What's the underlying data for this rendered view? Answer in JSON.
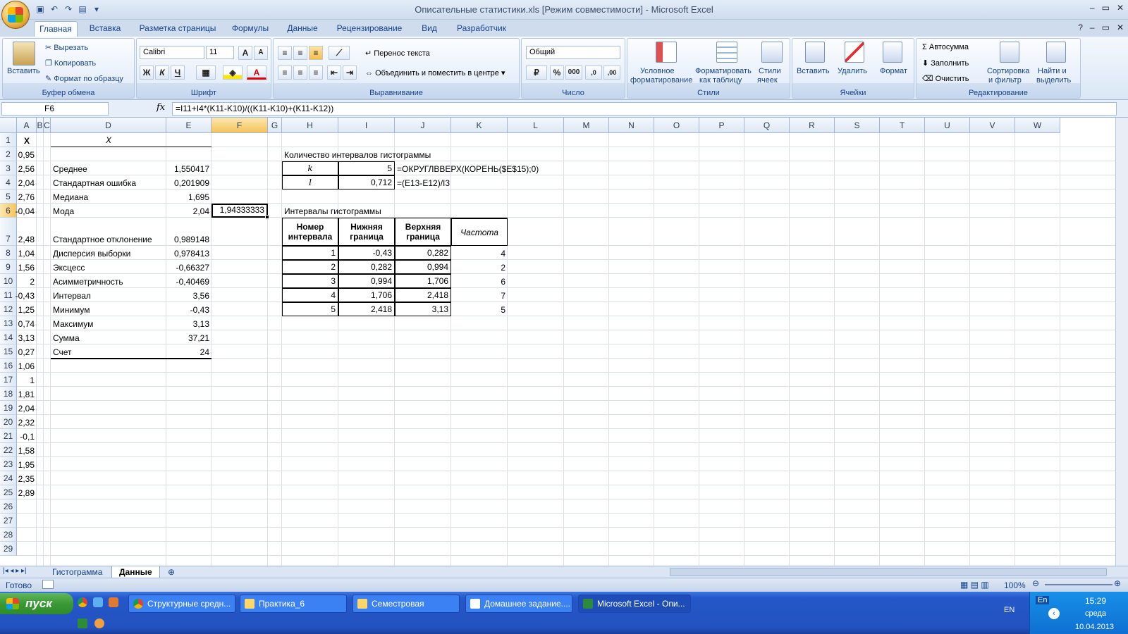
{
  "window": {
    "title": "Описательные статистики.xls  [Режим совместимости] - Microsoft Excel",
    "controls": [
      "–",
      "▭",
      "✕"
    ]
  },
  "ribbon_tabs": [
    "Главная",
    "Вставка",
    "Разметка страницы",
    "Формулы",
    "Данные",
    "Рецензирование",
    "Вид",
    "Разработчик"
  ],
  "active_tab": "Главная",
  "ribbon": {
    "clipboard": {
      "label": "Буфер обмена",
      "paste": "Вставить",
      "cut": "Вырезать",
      "copy": "Копировать",
      "format_painter": "Формат по образцу"
    },
    "font": {
      "label": "Шрифт",
      "name": "Calibri",
      "size": "11",
      "bold": "Ж",
      "italic": "К",
      "underline": "Ч",
      "grow": "A",
      "shrink": "A",
      "color_letter": "A"
    },
    "alignment": {
      "label": "Выравнивание",
      "wrap": "Перенос текста",
      "merge": "Объединить и поместить в центре"
    },
    "number": {
      "label": "Число",
      "format": "Общий",
      "percent": "%",
      "thousands": "000",
      "inc_dec": ",0",
      "dec_dec": ",00"
    },
    "styles": {
      "label": "Стили",
      "conditional": [
        "Условное",
        "форматирование"
      ],
      "as_table": [
        "Форматировать",
        "как таблицу"
      ],
      "cell_styles": [
        "Стили",
        "ячеек"
      ]
    },
    "cells": {
      "label": "Ячейки",
      "insert": "Вставить",
      "delete": "Удалить",
      "format": "Формат"
    },
    "editing": {
      "label": "Редактирование",
      "autosum": "Автосумма",
      "fill": "Заполнить",
      "clear": "Очистить",
      "sort": [
        "Сортировка",
        "и фильтр"
      ],
      "find": [
        "Найти и",
        "выделить"
      ]
    }
  },
  "formula_bar": {
    "name_box": "F6",
    "fx": "fx",
    "formula": "=I11+I4*(K11-K10)/((K11-K10)+(K11-K12))"
  },
  "columns": [
    "A",
    "B",
    "C",
    "D",
    "E",
    "F",
    "G",
    "H",
    "I",
    "J",
    "K",
    "L",
    "M",
    "N",
    "O",
    "P",
    "Q",
    "R",
    "S",
    "T",
    "U",
    "V",
    "W"
  ],
  "rows": [
    "1",
    "2",
    "3",
    "4",
    "5",
    "6",
    "7",
    "8",
    "9",
    "10",
    "11",
    "12",
    "13",
    "14",
    "15",
    "16",
    "17",
    "18",
    "19",
    "20",
    "21",
    "22",
    "23",
    "24",
    "25",
    "26",
    "27",
    "28",
    "29"
  ],
  "colA": {
    "header": "X",
    "values": [
      "0,95",
      "2,56",
      "2,04",
      "2,76",
      "-0,04",
      "2,48",
      "1,04",
      "1,56",
      "2",
      "-0,43",
      "1,25",
      "0,74",
      "3,13",
      "0,27",
      "1,06",
      "1",
      "1,81",
      "2,04",
      "2,32",
      "-0,1",
      "1,58",
      "1,95",
      "2,35",
      "2,89"
    ]
  },
  "stats": {
    "header": "X",
    "labels": [
      "Среднее",
      "Стандартная ошибка",
      "Медиана",
      "Мода",
      "Стандартное отклонение",
      "Дисперсия выборки",
      "Эксцесс",
      "Асимметричность",
      "Интервал",
      "Минимум",
      "Максимум",
      "Сумма",
      "Счет"
    ],
    "values": [
      "1,550417",
      "0,201909",
      "1,695",
      "2,04",
      "0,989148",
      "0,978413",
      "-0,66327",
      "-0,40469",
      "3,56",
      "-0,43",
      "3,13",
      "37,21",
      "24"
    ]
  },
  "active_cell_value": "1,94333333",
  "intervals": {
    "title": "Количество интервалов гистограммы",
    "k_label": "k",
    "k_value": "5",
    "k_formula": "=ОКРУГЛВВЕРХ(КОРЕНЬ($E$15);0)",
    "l_label": "l",
    "l_value": "0,712",
    "l_formula": "=(E13-E12)/I3"
  },
  "hist_table": {
    "title": "Интервалы гистограммы",
    "headers": [
      [
        "Номер",
        "интервала"
      ],
      [
        "Нижняя",
        "граница"
      ],
      [
        "Верхняя",
        "граница"
      ],
      [
        "Частота"
      ]
    ],
    "rows": [
      [
        "1",
        "-0,43",
        "0,282",
        "4"
      ],
      [
        "2",
        "0,282",
        "0,994",
        "2"
      ],
      [
        "3",
        "0,994",
        "1,706",
        "6"
      ],
      [
        "4",
        "1,706",
        "2,418",
        "7"
      ],
      [
        "5",
        "2,418",
        "3,13",
        "5"
      ]
    ]
  },
  "sheets": [
    "Гистограмма",
    "Данные"
  ],
  "active_sheet": "Данные",
  "status": {
    "ready": "Готово",
    "zoom": "100%"
  },
  "taskbar": {
    "start": "пуск",
    "tasks": [
      "Структурные средн...",
      "Практика_6",
      "Семестровая",
      "Домашнее задание....",
      "Microsoft Excel - Опи..."
    ],
    "lang": "EN",
    "lang2": "En",
    "time": "15:29",
    "day": "среда",
    "date": "10.04.2013"
  }
}
